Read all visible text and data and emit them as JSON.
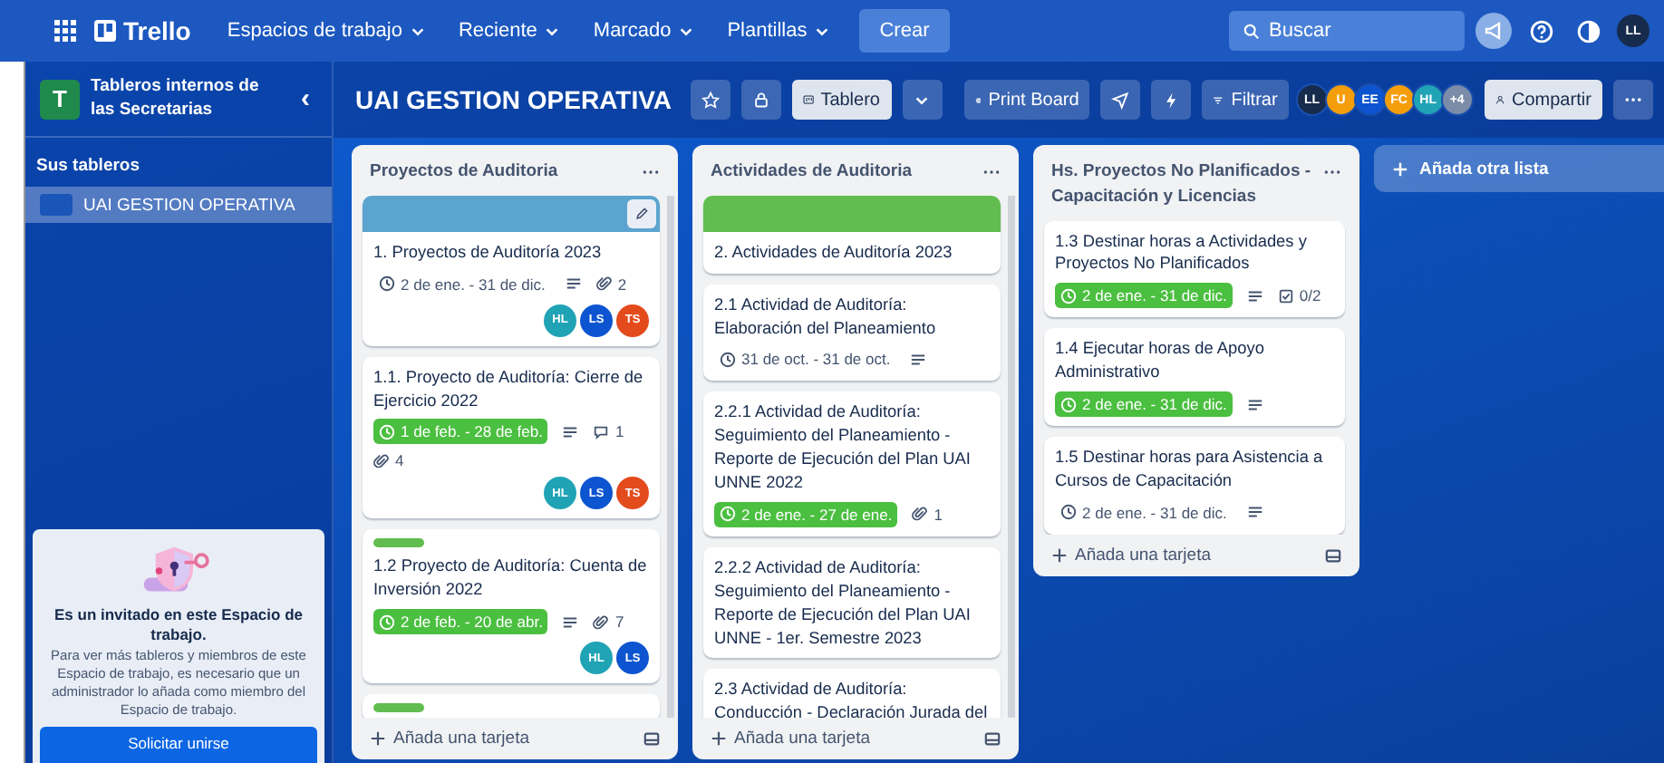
{
  "topbar": {
    "logo": "Trello",
    "menus": [
      {
        "label": "Espacios de trabajo"
      },
      {
        "label": "Reciente"
      },
      {
        "label": "Marcado"
      },
      {
        "label": "Plantillas"
      }
    ],
    "create": "Crear",
    "search": {
      "placeholder": "Buscar"
    },
    "user": {
      "initials": "LL",
      "color": "#172b4d"
    }
  },
  "sidebar": {
    "workspace_initial": "T",
    "workspace_name": "Tableros internos de las Secretarias",
    "collapse": "‹",
    "section": "Sus tableros",
    "boards": [
      {
        "name": "UAI GESTION OPERATIVA",
        "selected": true
      }
    ],
    "guest": {
      "title": "Es un invitado en este Espacio de trabajo.",
      "text": "Para ver más tableros y miembros de este Espacio de trabajo, es necesario que un administrador lo añada como miembro del Espacio de trabajo.",
      "button": "Solicitar unirse"
    }
  },
  "board": {
    "title": "UAI GESTION OPERATIVA",
    "starred": false,
    "view": "Tablero",
    "print": "Print Board",
    "filter": "Filtrar",
    "share": "Compartir",
    "members": [
      {
        "initials": "LL",
        "color": "#172b4d"
      },
      {
        "initials": "U",
        "color": "#f59e0b"
      },
      {
        "initials": "EE",
        "color": "#0c54d0"
      },
      {
        "initials": "FC",
        "color": "#f59e0b"
      },
      {
        "initials": "HL",
        "color": "#1fa3b5"
      }
    ],
    "more_members": "+4"
  },
  "lists": [
    {
      "title": "Proyectos de Auditoria",
      "add": "Añada una tarjeta",
      "cards": [
        {
          "cover": {
            "color": "#5ba4cf"
          },
          "hovered": true,
          "title": "1. Proyectos de Auditoría 2023",
          "date": {
            "text": "2 de ene. - 31 de dic.",
            "complete": false
          },
          "description": true,
          "attachments": "2",
          "members": [
            {
              "initials": "HL",
              "color": "#1fa3b5"
            },
            {
              "initials": "LS",
              "color": "#0c54d0"
            },
            {
              "initials": "TS",
              "color": "#e34a1c"
            }
          ]
        },
        {
          "title": "1.1. Proyecto de Auditoría: Cierre de Ejercicio 2022",
          "date": {
            "text": "1 de feb. - 28 de feb.",
            "complete": true
          },
          "description": true,
          "comments": "1",
          "attachments": "4",
          "members": [
            {
              "initials": "HL",
              "color": "#1fa3b5"
            },
            {
              "initials": "LS",
              "color": "#0c54d0"
            },
            {
              "initials": "TS",
              "color": "#e34a1c"
            }
          ]
        },
        {
          "label": {
            "color": "#61bd4f"
          },
          "title": "1.2 Proyecto de Auditoría: Cuenta de Inversión 2022",
          "date": {
            "text": "2 de feb. - 20 de abr.",
            "complete": true
          },
          "description": true,
          "attachments": "7",
          "members": [
            {
              "initials": "HL",
              "color": "#1fa3b5"
            },
            {
              "initials": "LS",
              "color": "#0c54d0"
            }
          ]
        },
        {
          "label": {
            "color": "#61bd4f"
          }
        }
      ]
    },
    {
      "title": "Actividades de Auditoria",
      "add": "Añada una tarjeta",
      "cards": [
        {
          "cover": {
            "color": "#61bd4f"
          },
          "title": "2. Actividades de Auditoría 2023"
        },
        {
          "title": "2.1 Actividad de Auditoría: Elaboración del Planeamiento",
          "date": {
            "text": "31 de oct. - 31 de oct.",
            "complete": false
          },
          "description": true
        },
        {
          "title": "2.2.1 Actividad de Auditoría: Seguimiento del Planeamiento - Reporte de Ejecución del Plan UAI UNNE 2022",
          "date": {
            "text": "2 de ene. - 27 de ene.",
            "complete": true
          },
          "attachments": "1"
        },
        {
          "title": "2.2.2 Actividad de Auditoría: Seguimiento del Planeamiento - Reporte de Ejecución del Plan UAI UNNE - 1er. Semestre 2023"
        },
        {
          "title": "2.3 Actividad de Auditoría: Conducción - Declaración Jurada del"
        }
      ]
    },
    {
      "title": "Hs. Proyectos No Planificados - Capacitación y Licencias",
      "add": "Añada una tarjeta",
      "cards": [
        {
          "title": "1.3 Destinar horas a Actividades y Proyectos No Planificados",
          "date": {
            "text": "2 de ene. - 31 de dic.",
            "complete": true
          },
          "description": true,
          "checklist": "0/2"
        },
        {
          "title": "1.4 Ejecutar horas de Apoyo Administrativo",
          "date": {
            "text": "2 de ene. - 31 de dic.",
            "complete": true
          },
          "description": true
        },
        {
          "title": "1.5 Destinar horas para Asistencia a Cursos de Capacitación",
          "date": {
            "text": "2 de ene. - 31 de dic.",
            "complete": false
          },
          "description": true
        }
      ]
    }
  ],
  "add_list": "Añada otra lista"
}
